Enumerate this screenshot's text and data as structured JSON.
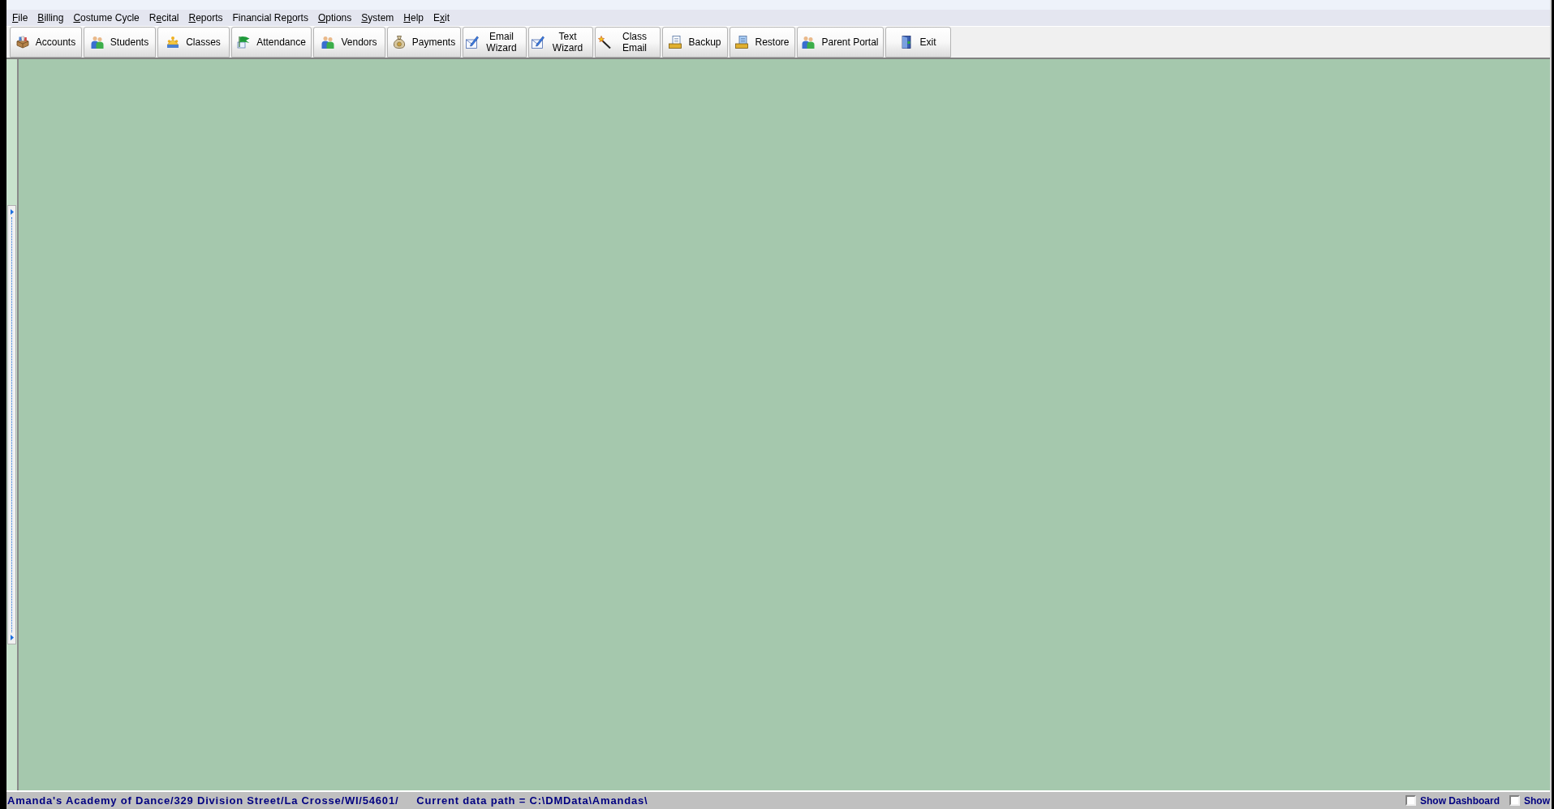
{
  "menu_bar": [
    {
      "access_key": "F",
      "text_after": "ile"
    },
    {
      "access_key": "B",
      "text_after": "illing"
    },
    {
      "access_key": "C",
      "text_after": "ostume Cycle"
    },
    {
      "text_before": "R",
      "access_key": "e",
      "text_after": "cital"
    },
    {
      "access_key": "R",
      "text_after": "eports"
    },
    {
      "text_before": "Financial Re",
      "access_key": "p",
      "text_after": "orts"
    },
    {
      "access_key": "O",
      "text_after": "ptions"
    },
    {
      "access_key": "S",
      "text_after": "ystem"
    },
    {
      "access_key": "H",
      "text_after": "elp"
    },
    {
      "text_before": "E",
      "access_key": "x",
      "text_after": "it"
    }
  ],
  "toolbar": [
    {
      "lines": [
        "Accounts"
      ]
    },
    {
      "lines": [
        "Students"
      ]
    },
    {
      "lines": [
        "Classes"
      ]
    },
    {
      "lines": [
        "Attendance"
      ]
    },
    {
      "lines": [
        "Vendors"
      ]
    },
    {
      "lines": [
        "Payments"
      ]
    },
    {
      "lines": [
        "Email",
        "Wizard"
      ]
    },
    {
      "lines": [
        "Text",
        "Wizard"
      ]
    },
    {
      "lines": [
        "Class",
        "Email"
      ]
    },
    {
      "lines": [
        "Backup"
      ]
    },
    {
      "lines": [
        "Restore"
      ]
    },
    {
      "lines": [
        "Parent Portal"
      ]
    },
    {
      "lines": [
        "Exit"
      ]
    }
  ],
  "status_bar": {
    "address": "Amanda's Academy of Dance/329 Division Street/La Crosse/WI/54601/",
    "data_path": "Current data path = C:\\DMData\\Amandas\\",
    "checkboxes": [
      {
        "label": "Show Dashboard",
        "checked": false
      },
      {
        "label": "Show",
        "checked": false
      }
    ]
  }
}
